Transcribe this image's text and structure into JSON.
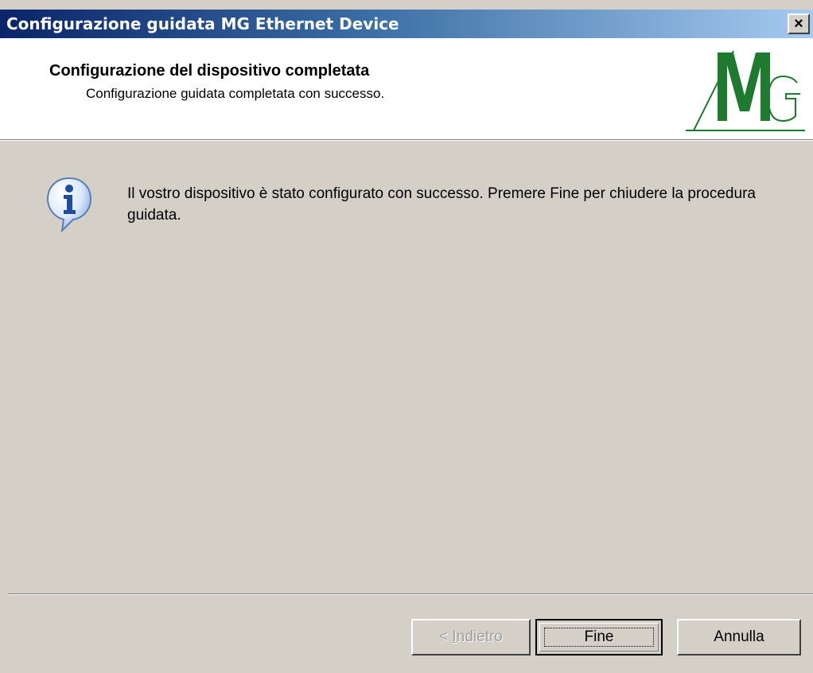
{
  "window": {
    "title": "Configurazione guidata MG Ethernet Device",
    "close_label": "×"
  },
  "header": {
    "title": "Configurazione del dispositivo completata",
    "subtitle": "Configurazione guidata completata con successo.",
    "logo_icon": "mg-logo-icon"
  },
  "body": {
    "icon": "info-icon",
    "message": "Il vostro dispositivo è stato configurato con successo.  Premere Fine per chiudere la procedura guidata."
  },
  "buttons": {
    "back_prefix": "< ",
    "back_accel": "I",
    "back_rest": "ndietro",
    "finish": "Fine",
    "cancel": "Annulla"
  },
  "colors": {
    "title_start": "#0a246a",
    "title_end": "#a6caf0",
    "logo_green": "#1e7a2e",
    "face": "#d4d0c8"
  }
}
